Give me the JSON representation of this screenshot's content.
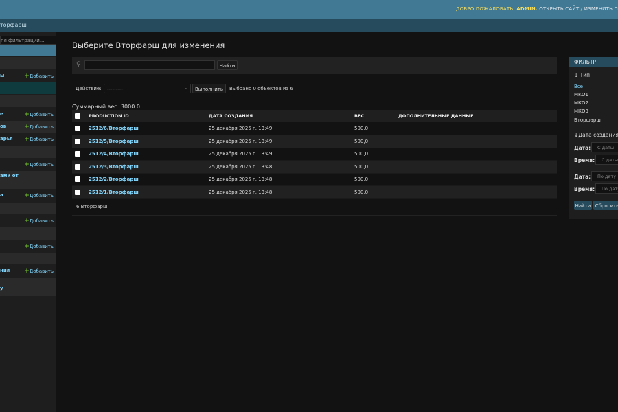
{
  "header": {
    "welcome": "ДОБРО ПОЖАЛОВАТЬ,",
    "user": "ADMIN.",
    "view_site": "ОТКРЫТЬ САЙТ",
    "sep": "/",
    "change_password": "ИЗМЕНИТЬ П"
  },
  "breadcrumbs": "торфарш",
  "sidebar": {
    "filter_placeholder": "пя фильтрации...",
    "add": "Добавить",
    "items": [
      "ы",
      "е",
      "ов",
      "арья",
      "ами от",
      "а",
      "ния",
      "у"
    ]
  },
  "page_title": "Выберите Вторфарш для изменения",
  "search": {
    "button": "Найти",
    "value": ""
  },
  "actions": {
    "label": "Действие:",
    "selected": "---------",
    "run": "Выполнить",
    "counter": "Выбрано 0 объектов из 6"
  },
  "summary": "Суммарный вес: 3000.0",
  "table": {
    "headers": [
      "PRODUCTION ID",
      "ДАТА СОЗДАНИЯ",
      "ВЕС",
      "ДОПОЛНИТЕЛЬНЫЕ ДАННЫЕ"
    ],
    "rows": [
      {
        "id": "2512/6/Вторфарш",
        "date": "25 декабря 2025 г. 13:49",
        "weight": "500,0",
        "extra": ""
      },
      {
        "id": "2512/5/Вторфарш",
        "date": "25 декабря 2025 г. 13:49",
        "weight": "500,0",
        "extra": ""
      },
      {
        "id": "2512/4/Вторфарш",
        "date": "25 декабря 2025 г. 13:49",
        "weight": "500,0",
        "extra": ""
      },
      {
        "id": "2512/3/Вторфарш",
        "date": "25 декабря 2025 г. 13:48",
        "weight": "500,0",
        "extra": ""
      },
      {
        "id": "2512/2/Вторфарш",
        "date": "25 декабря 2025 г. 13:48",
        "weight": "500,0",
        "extra": ""
      },
      {
        "id": "2512/1/Вторфарш",
        "date": "25 декабря 2025 г. 13:48",
        "weight": "500,0",
        "extra": ""
      }
    ]
  },
  "paginator": "6 Вторфарш",
  "filter": {
    "title": "ФИЛЬТР",
    "type_heading": "↓ Тип",
    "type_options": [
      "Все",
      "МКО1",
      "МКО2",
      "МКО3",
      "Вторфарш"
    ],
    "date_heading": "↓Дата создания",
    "date_label": "Дата:",
    "time_label": "Время:",
    "from_placeholder": "С даты",
    "to_placeholder": "По дату",
    "search": "Найти",
    "reset": "Сбросить"
  }
}
